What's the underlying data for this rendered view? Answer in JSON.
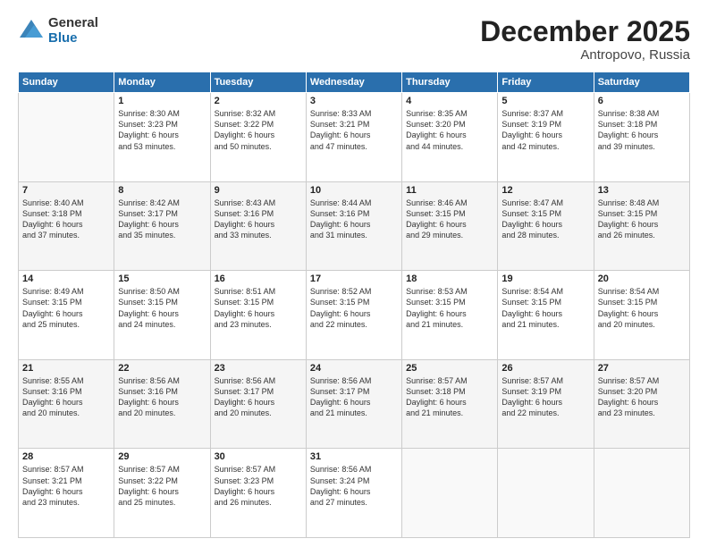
{
  "logo": {
    "general": "General",
    "blue": "Blue"
  },
  "header": {
    "month": "December 2025",
    "location": "Antropovo, Russia"
  },
  "weekdays": [
    "Sunday",
    "Monday",
    "Tuesday",
    "Wednesday",
    "Thursday",
    "Friday",
    "Saturday"
  ],
  "weeks": [
    [
      {
        "day": "",
        "info": ""
      },
      {
        "day": "1",
        "info": "Sunrise: 8:30 AM\nSunset: 3:23 PM\nDaylight: 6 hours\nand 53 minutes."
      },
      {
        "day": "2",
        "info": "Sunrise: 8:32 AM\nSunset: 3:22 PM\nDaylight: 6 hours\nand 50 minutes."
      },
      {
        "day": "3",
        "info": "Sunrise: 8:33 AM\nSunset: 3:21 PM\nDaylight: 6 hours\nand 47 minutes."
      },
      {
        "day": "4",
        "info": "Sunrise: 8:35 AM\nSunset: 3:20 PM\nDaylight: 6 hours\nand 44 minutes."
      },
      {
        "day": "5",
        "info": "Sunrise: 8:37 AM\nSunset: 3:19 PM\nDaylight: 6 hours\nand 42 minutes."
      },
      {
        "day": "6",
        "info": "Sunrise: 8:38 AM\nSunset: 3:18 PM\nDaylight: 6 hours\nand 39 minutes."
      }
    ],
    [
      {
        "day": "7",
        "info": "Sunrise: 8:40 AM\nSunset: 3:18 PM\nDaylight: 6 hours\nand 37 minutes."
      },
      {
        "day": "8",
        "info": "Sunrise: 8:42 AM\nSunset: 3:17 PM\nDaylight: 6 hours\nand 35 minutes."
      },
      {
        "day": "9",
        "info": "Sunrise: 8:43 AM\nSunset: 3:16 PM\nDaylight: 6 hours\nand 33 minutes."
      },
      {
        "day": "10",
        "info": "Sunrise: 8:44 AM\nSunset: 3:16 PM\nDaylight: 6 hours\nand 31 minutes."
      },
      {
        "day": "11",
        "info": "Sunrise: 8:46 AM\nSunset: 3:15 PM\nDaylight: 6 hours\nand 29 minutes."
      },
      {
        "day": "12",
        "info": "Sunrise: 8:47 AM\nSunset: 3:15 PM\nDaylight: 6 hours\nand 28 minutes."
      },
      {
        "day": "13",
        "info": "Sunrise: 8:48 AM\nSunset: 3:15 PM\nDaylight: 6 hours\nand 26 minutes."
      }
    ],
    [
      {
        "day": "14",
        "info": "Sunrise: 8:49 AM\nSunset: 3:15 PM\nDaylight: 6 hours\nand 25 minutes."
      },
      {
        "day": "15",
        "info": "Sunrise: 8:50 AM\nSunset: 3:15 PM\nDaylight: 6 hours\nand 24 minutes."
      },
      {
        "day": "16",
        "info": "Sunrise: 8:51 AM\nSunset: 3:15 PM\nDaylight: 6 hours\nand 23 minutes."
      },
      {
        "day": "17",
        "info": "Sunrise: 8:52 AM\nSunset: 3:15 PM\nDaylight: 6 hours\nand 22 minutes."
      },
      {
        "day": "18",
        "info": "Sunrise: 8:53 AM\nSunset: 3:15 PM\nDaylight: 6 hours\nand 21 minutes."
      },
      {
        "day": "19",
        "info": "Sunrise: 8:54 AM\nSunset: 3:15 PM\nDaylight: 6 hours\nand 21 minutes."
      },
      {
        "day": "20",
        "info": "Sunrise: 8:54 AM\nSunset: 3:15 PM\nDaylight: 6 hours\nand 20 minutes."
      }
    ],
    [
      {
        "day": "21",
        "info": "Sunrise: 8:55 AM\nSunset: 3:16 PM\nDaylight: 6 hours\nand 20 minutes."
      },
      {
        "day": "22",
        "info": "Sunrise: 8:56 AM\nSunset: 3:16 PM\nDaylight: 6 hours\nand 20 minutes."
      },
      {
        "day": "23",
        "info": "Sunrise: 8:56 AM\nSunset: 3:17 PM\nDaylight: 6 hours\nand 20 minutes."
      },
      {
        "day": "24",
        "info": "Sunrise: 8:56 AM\nSunset: 3:17 PM\nDaylight: 6 hours\nand 21 minutes."
      },
      {
        "day": "25",
        "info": "Sunrise: 8:57 AM\nSunset: 3:18 PM\nDaylight: 6 hours\nand 21 minutes."
      },
      {
        "day": "26",
        "info": "Sunrise: 8:57 AM\nSunset: 3:19 PM\nDaylight: 6 hours\nand 22 minutes."
      },
      {
        "day": "27",
        "info": "Sunrise: 8:57 AM\nSunset: 3:20 PM\nDaylight: 6 hours\nand 23 minutes."
      }
    ],
    [
      {
        "day": "28",
        "info": "Sunrise: 8:57 AM\nSunset: 3:21 PM\nDaylight: 6 hours\nand 23 minutes."
      },
      {
        "day": "29",
        "info": "Sunrise: 8:57 AM\nSunset: 3:22 PM\nDaylight: 6 hours\nand 25 minutes."
      },
      {
        "day": "30",
        "info": "Sunrise: 8:57 AM\nSunset: 3:23 PM\nDaylight: 6 hours\nand 26 minutes."
      },
      {
        "day": "31",
        "info": "Sunrise: 8:56 AM\nSunset: 3:24 PM\nDaylight: 6 hours\nand 27 minutes."
      },
      {
        "day": "",
        "info": ""
      },
      {
        "day": "",
        "info": ""
      },
      {
        "day": "",
        "info": ""
      }
    ]
  ]
}
